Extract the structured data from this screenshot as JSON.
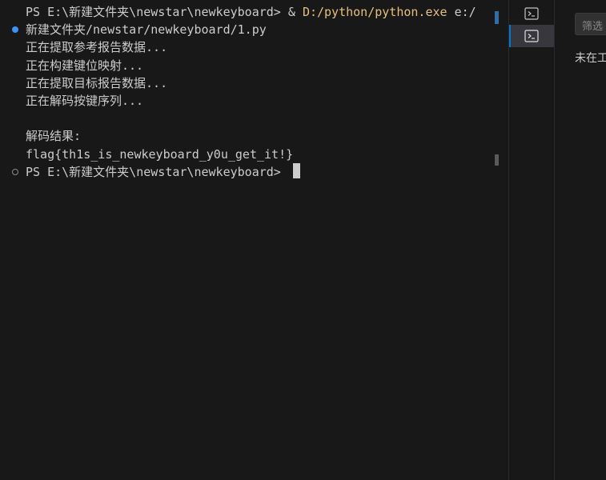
{
  "terminal": {
    "line1": {
      "prompt": "PS E:\\新建文件夹\\newstar\\newkeyboard> ",
      "operator": "& ",
      "exe": "D:/python/python.exe",
      "arg_start": " e:/"
    },
    "line2": "新建文件夹/newstar/newkeyboard/1.py",
    "output": [
      "正在提取参考报告数据...",
      "正在构建键位映射...",
      "正在提取目标报告数据...",
      "正在解码按键序列..."
    ],
    "result_label": "解码结果:",
    "flag": "flag{th1s_is_newkeyboard_y0u_get_it!}",
    "current_prompt": "PS E:\\新建文件夹\\newstar\\newkeyboard> "
  },
  "tabs": [
    {
      "icon": "terminal-icon",
      "active": false
    },
    {
      "icon": "terminal-icon",
      "active": true
    }
  ],
  "panel": {
    "filter_placeholder": "筛选",
    "message": "未在工"
  },
  "colors": {
    "background": "#181818",
    "text": "#cccccc",
    "exe_highlight": "#e5c07b",
    "success_decoration": "#3794ff",
    "active_tab": "#37373d",
    "focus_border": "#0078d4"
  }
}
